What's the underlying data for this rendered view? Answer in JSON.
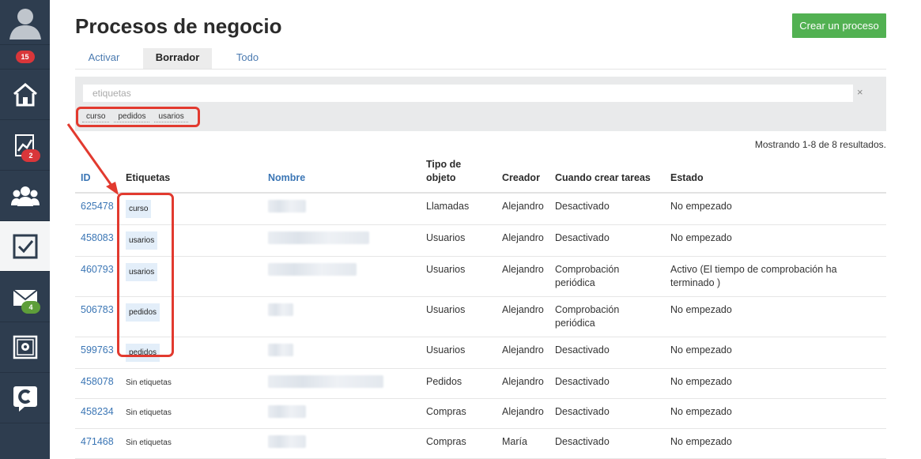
{
  "sidebar": {
    "notifications_badge": "15",
    "items": [
      {
        "name": "home",
        "icon": "home-icon",
        "badge": ""
      },
      {
        "name": "stats",
        "icon": "chart-icon",
        "badge": "2"
      },
      {
        "name": "users",
        "icon": "users-icon",
        "badge": ""
      },
      {
        "name": "tasks",
        "icon": "checkbox-icon",
        "badge": ""
      },
      {
        "name": "mail",
        "icon": "mail-icon",
        "badge": "4"
      },
      {
        "name": "safe",
        "icon": "safe-icon",
        "badge": ""
      },
      {
        "name": "chat",
        "icon": "chat-logo-icon",
        "badge": ""
      }
    ]
  },
  "page": {
    "title": "Procesos de negocio",
    "create_button": "Crear un proceso"
  },
  "tabs": [
    "Activar",
    "Borrador",
    "Todo"
  ],
  "active_tab": "Borrador",
  "filter": {
    "placeholder": "etiquetas",
    "clear": "×",
    "tags": [
      "curso",
      "pedidos",
      "usarios"
    ]
  },
  "results_info": "Mostrando 1-8 de 8 resultados.",
  "table": {
    "headers": {
      "id": "ID",
      "tags": "Etiquetas",
      "name": "Nombre",
      "object_type": "Tipo de objeto",
      "creator": "Creador",
      "when": "Cuando crear tareas",
      "status": "Estado"
    },
    "rows": [
      {
        "id": "625478",
        "tag": "curso",
        "type": "Llamadas",
        "creator": "Alejandro",
        "when": "Desactivado",
        "status": "No empezado"
      },
      {
        "id": "458083",
        "tag": "usarios",
        "type": "Usuarios",
        "creator": "Alejandro",
        "when": "Desactivado",
        "status": "No empezado"
      },
      {
        "id": "460793",
        "tag": "usarios",
        "type": "Usuarios",
        "creator": "Alejandro",
        "when": "Comprobación periódica",
        "status": "Activo (El tiempo de comprobación ha terminado )"
      },
      {
        "id": "506783",
        "tag": "pedidos",
        "type": "Usuarios",
        "creator": "Alejandro",
        "when": "Comprobación periódica",
        "status": "No empezado"
      },
      {
        "id": "599763",
        "tag": "pedidos",
        "type": "Usuarios",
        "creator": "Alejandro",
        "when": "Desactivado",
        "status": "No empezado"
      },
      {
        "id": "458078",
        "tag": "Sin etiquetas",
        "type": "Pedidos",
        "creator": "Alejandro",
        "when": "Desactivado",
        "status": "No empezado"
      },
      {
        "id": "458234",
        "tag": "Sin etiquetas",
        "type": "Compras",
        "creator": "Alejandro",
        "when": "Desactivado",
        "status": "No empezado"
      },
      {
        "id": "471468",
        "tag": "Sin etiquetas",
        "type": "Compras",
        "creator": "María",
        "when": "Desactivado",
        "status": "No empezado"
      }
    ]
  }
}
